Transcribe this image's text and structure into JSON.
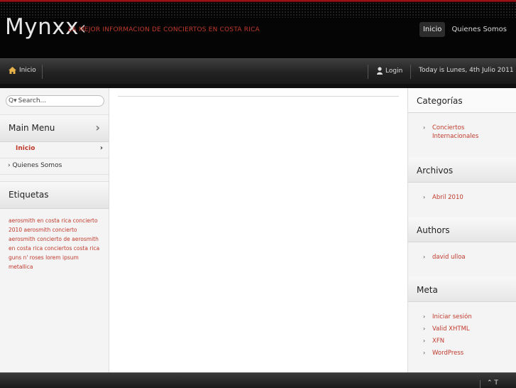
{
  "header": {
    "logo": "Mynxx",
    "tagline": "LA MEJOR INFORMACION DE CONCIERTOS EN COSTA RICA",
    "topnav": [
      {
        "label": "Inicio"
      },
      {
        "label": "Quienes Somos"
      }
    ]
  },
  "navbar": {
    "home_label": "Inicio",
    "login_label": "Login",
    "today": "Today is Lunes, 4th Julio 2011"
  },
  "sidebar": {
    "search_placeholder": "Search...",
    "main_menu_title": "Main Menu",
    "menu": [
      {
        "label": "Inicio"
      },
      {
        "label": "Quienes Somos"
      }
    ],
    "tags_title": "Etiquetas",
    "tags": [
      "aerosmith en costa rica",
      "concierto 2010",
      "aerosmith",
      "concierto aerosmith",
      "concierto de aerosmith en costa rica",
      "conciertos costa rica",
      "guns n' roses",
      "lorem ipsum",
      "metallica"
    ]
  },
  "right": {
    "categories_title": "Categorías",
    "categories": [
      "Conciertos Internacionales"
    ],
    "archives_title": "Archivos",
    "archives": [
      "Abril 2010"
    ],
    "authors_title": "Authors",
    "authors": [
      "david ulloa"
    ],
    "meta_title": "Meta",
    "meta": [
      "Iniciar sesión",
      "Valid XHTML",
      "XFN",
      "WordPress"
    ]
  },
  "footer": {
    "top_label": "T"
  },
  "colors": {
    "accent": "#c0392b",
    "header_bg": "#050505",
    "navbar_bg": "#222222",
    "column_bg": "#f4f4f4"
  }
}
